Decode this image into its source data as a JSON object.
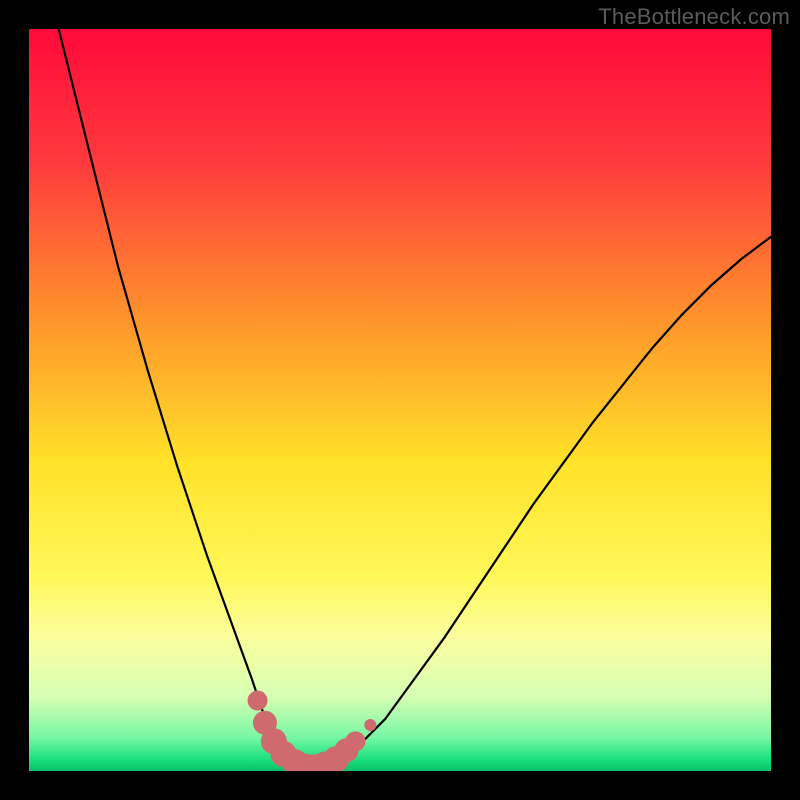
{
  "watermark": "TheBottleneck.com",
  "chart_data": {
    "type": "line",
    "title": "",
    "xlabel": "",
    "ylabel": "",
    "xlim": [
      0,
      100
    ],
    "ylim": [
      0,
      100
    ],
    "gradient_stops": [
      {
        "pos": 0.0,
        "color": "#ff0a3a"
      },
      {
        "pos": 0.18,
        "color": "#ff3a3d"
      },
      {
        "pos": 0.38,
        "color": "#ff8f2c"
      },
      {
        "pos": 0.58,
        "color": "#ffe128"
      },
      {
        "pos": 0.74,
        "color": "#fff85a"
      },
      {
        "pos": 0.82,
        "color": "#fbff9e"
      },
      {
        "pos": 0.9,
        "color": "#d6ffb3"
      },
      {
        "pos": 0.955,
        "color": "#76f7a3"
      },
      {
        "pos": 0.985,
        "color": "#18e07e"
      },
      {
        "pos": 1.0,
        "color": "#0bbf6b"
      }
    ],
    "series": [
      {
        "name": "bottleneck-curve",
        "x": [
          4,
          6,
          8,
          10,
          12,
          14,
          16,
          18,
          20,
          22,
          24,
          26,
          28,
          30,
          31.5,
          33,
          34.5,
          36,
          38,
          40,
          44,
          48,
          52,
          56,
          60,
          64,
          68,
          72,
          76,
          80,
          84,
          88,
          92,
          96,
          100
        ],
        "y": [
          100,
          92,
          84,
          76,
          68,
          61,
          54,
          47.5,
          41,
          35,
          29,
          23.5,
          18,
          12.5,
          8,
          4.5,
          2,
          0.7,
          0.2,
          0.6,
          3,
          7,
          12.5,
          18,
          24,
          30,
          36,
          41.5,
          47,
          52,
          57,
          61.5,
          65.5,
          69,
          72
        ]
      }
    ],
    "markers": {
      "name": "optimal-range-markers",
      "color": "#cf6a6f",
      "points": [
        {
          "x": 30.8,
          "y": 9.5,
          "r": 10
        },
        {
          "x": 31.8,
          "y": 6.5,
          "r": 12
        },
        {
          "x": 33.0,
          "y": 4.0,
          "r": 13
        },
        {
          "x": 34.3,
          "y": 2.3,
          "r": 13
        },
        {
          "x": 35.8,
          "y": 1.2,
          "r": 13
        },
        {
          "x": 37.2,
          "y": 0.6,
          "r": 13
        },
        {
          "x": 38.6,
          "y": 0.5,
          "r": 13
        },
        {
          "x": 40.0,
          "y": 0.9,
          "r": 13
        },
        {
          "x": 41.4,
          "y": 1.6,
          "r": 13
        },
        {
          "x": 42.8,
          "y": 2.8,
          "r": 12
        },
        {
          "x": 44.0,
          "y": 4.0,
          "r": 10
        },
        {
          "x": 46.0,
          "y": 6.2,
          "r": 6
        }
      ]
    }
  }
}
